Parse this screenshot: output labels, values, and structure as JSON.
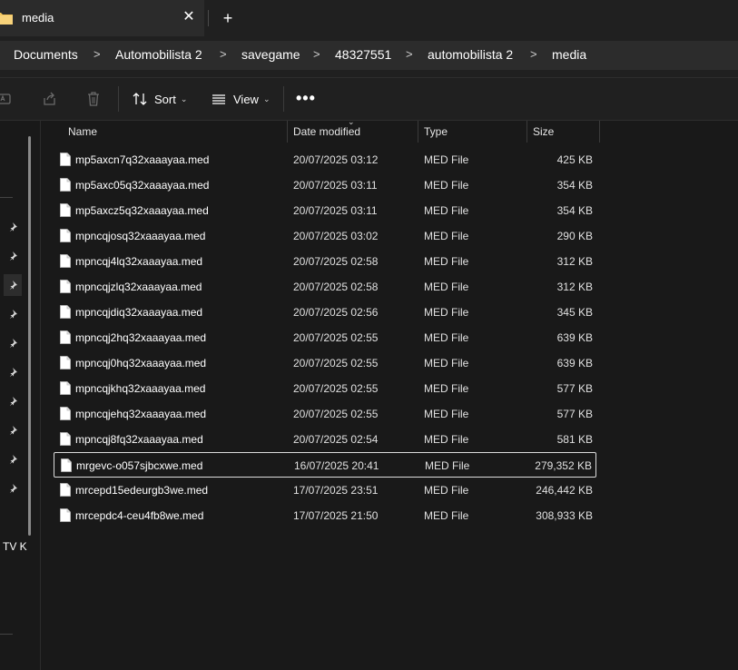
{
  "tab": {
    "title": "media",
    "close_glyph": "✕",
    "new_glyph": "+"
  },
  "breadcrumb": [
    "Documents",
    "Automobilista 2",
    "savegame",
    "48327551",
    "automobilista 2",
    "media"
  ],
  "toolbar": {
    "sort_label": "Sort",
    "view_label": "View",
    "more_label": "•••"
  },
  "sidebar": {
    "partial_label": "TV K"
  },
  "columns": {
    "name": "Name",
    "date": "Date modified",
    "type": "Type",
    "size": "Size"
  },
  "files": [
    {
      "name": "mp5axcn7q32xaaayaa.med",
      "date": "20/07/2025 03:12",
      "type": "MED File",
      "size": "425 KB"
    },
    {
      "name": "mp5axc05q32xaaayaa.med",
      "date": "20/07/2025 03:11",
      "type": "MED File",
      "size": "354 KB"
    },
    {
      "name": "mp5axcz5q32xaaayaa.med",
      "date": "20/07/2025 03:11",
      "type": "MED File",
      "size": "354 KB"
    },
    {
      "name": "mpncqjosq32xaaayaa.med",
      "date": "20/07/2025 03:02",
      "type": "MED File",
      "size": "290 KB"
    },
    {
      "name": "mpncqj4lq32xaaayaa.med",
      "date": "20/07/2025 02:58",
      "type": "MED File",
      "size": "312 KB"
    },
    {
      "name": "mpncqjzlq32xaaayaa.med",
      "date": "20/07/2025 02:58",
      "type": "MED File",
      "size": "312 KB"
    },
    {
      "name": "mpncqjdiq32xaaayaa.med",
      "date": "20/07/2025 02:56",
      "type": "MED File",
      "size": "345 KB"
    },
    {
      "name": "mpncqj2hq32xaaayaa.med",
      "date": "20/07/2025 02:55",
      "type": "MED File",
      "size": "639 KB"
    },
    {
      "name": "mpncqj0hq32xaaayaa.med",
      "date": "20/07/2025 02:55",
      "type": "MED File",
      "size": "639 KB"
    },
    {
      "name": "mpncqjkhq32xaaayaa.med",
      "date": "20/07/2025 02:55",
      "type": "MED File",
      "size": "577 KB"
    },
    {
      "name": "mpncqjehq32xaaayaa.med",
      "date": "20/07/2025 02:55",
      "type": "MED File",
      "size": "577 KB"
    },
    {
      "name": "mpncqj8fq32xaaayaa.med",
      "date": "20/07/2025 02:54",
      "type": "MED File",
      "size": "581 KB"
    },
    {
      "name": "mrgevc-o057sjbcxwe.med",
      "date": "16/07/2025 20:41",
      "type": "MED File",
      "size": "279,352 KB",
      "focused": true
    },
    {
      "name": "mrcepd15edeurgb3we.med",
      "date": "17/07/2025 23:51",
      "type": "MED File",
      "size": "246,442 KB"
    },
    {
      "name": "mrcepdc4-ceu4fb8we.med",
      "date": "17/07/2025 21:50",
      "type": "MED File",
      "size": "308,933 KB"
    }
  ],
  "icons": {
    "tab": "folder-icon",
    "toolbar": [
      "rename-icon",
      "share-icon",
      "delete-icon",
      "sort-icon",
      "view-icon",
      "more-icon"
    ],
    "sidebar": "pin-icon",
    "file": "file-icon"
  },
  "colors": {
    "background": "#191919",
    "chrome": "#202020",
    "address_bar": "#2c2c2c",
    "folder": "#f2c55c",
    "focus_border": "#dcdcdc"
  }
}
